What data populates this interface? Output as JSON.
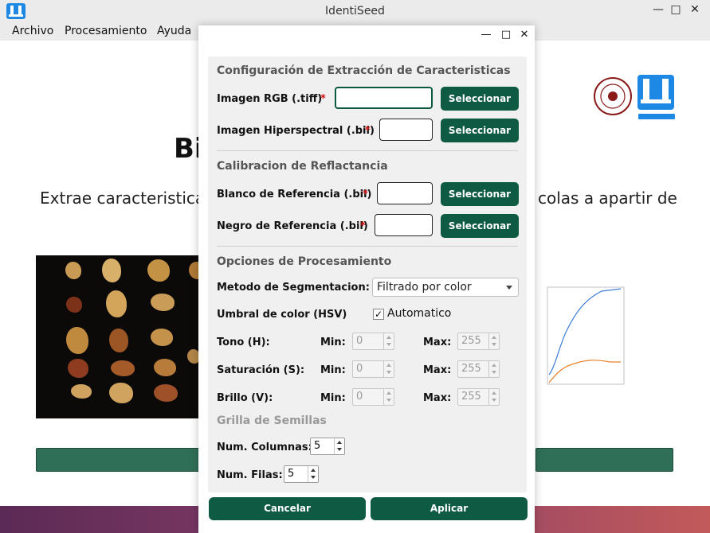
{
  "window": {
    "title": "IdentiSeed"
  },
  "menu": {
    "items": [
      "Archivo",
      "Procesamiento",
      "Ayuda"
    ]
  },
  "background": {
    "heading_fragment": "Bi",
    "subtitle_left": "Extrae caracteristica",
    "subtitle_right": "colas a apartir de"
  },
  "dialog": {
    "sections": {
      "extraction": "Configuración de Extracción de Caracteristicas",
      "calibration": "Calibracion de Reflactancia",
      "processing": "Opciones de Procesamiento",
      "grid": "Grilla de Semillas"
    },
    "fields": {
      "rgb": {
        "label": "Imagen RGB (.tiff)",
        "required": "*",
        "value": ""
      },
      "hyper": {
        "label": "Imagen Hiperspectral (.bil)",
        "required": "*",
        "value": ""
      },
      "white": {
        "label": "Blanco de Referencia (.bil)",
        "required": "*",
        "value": ""
      },
      "black": {
        "label": "Negro de Referencia (.bil)",
        "required": "*",
        "value": ""
      }
    },
    "select_label": "Seleccionar",
    "segmentation": {
      "label": "Metodo de Segmentacion:",
      "value": "Filtrado por color"
    },
    "threshold": {
      "label": "Umbral de color (HSV)",
      "auto_label": "Automatico",
      "auto_checked": true
    },
    "min_label": "Min:",
    "max_label": "Max:",
    "hsv": [
      {
        "label": "Tono (H):",
        "min": "0",
        "max": "255"
      },
      {
        "label": "Saturación (S):",
        "min": "0",
        "max": "255"
      },
      {
        "label": "Brillo (V):",
        "min": "0",
        "max": "255"
      }
    ],
    "grid": {
      "columns_label": "Num. Columnas:",
      "columns": "5",
      "rows_label": "Num. Filas:",
      "rows": "5"
    },
    "buttons": {
      "cancel": "Cancelar",
      "apply": "Aplicar"
    }
  },
  "colors": {
    "accent": "#0f5a43",
    "required": "#d01010"
  }
}
